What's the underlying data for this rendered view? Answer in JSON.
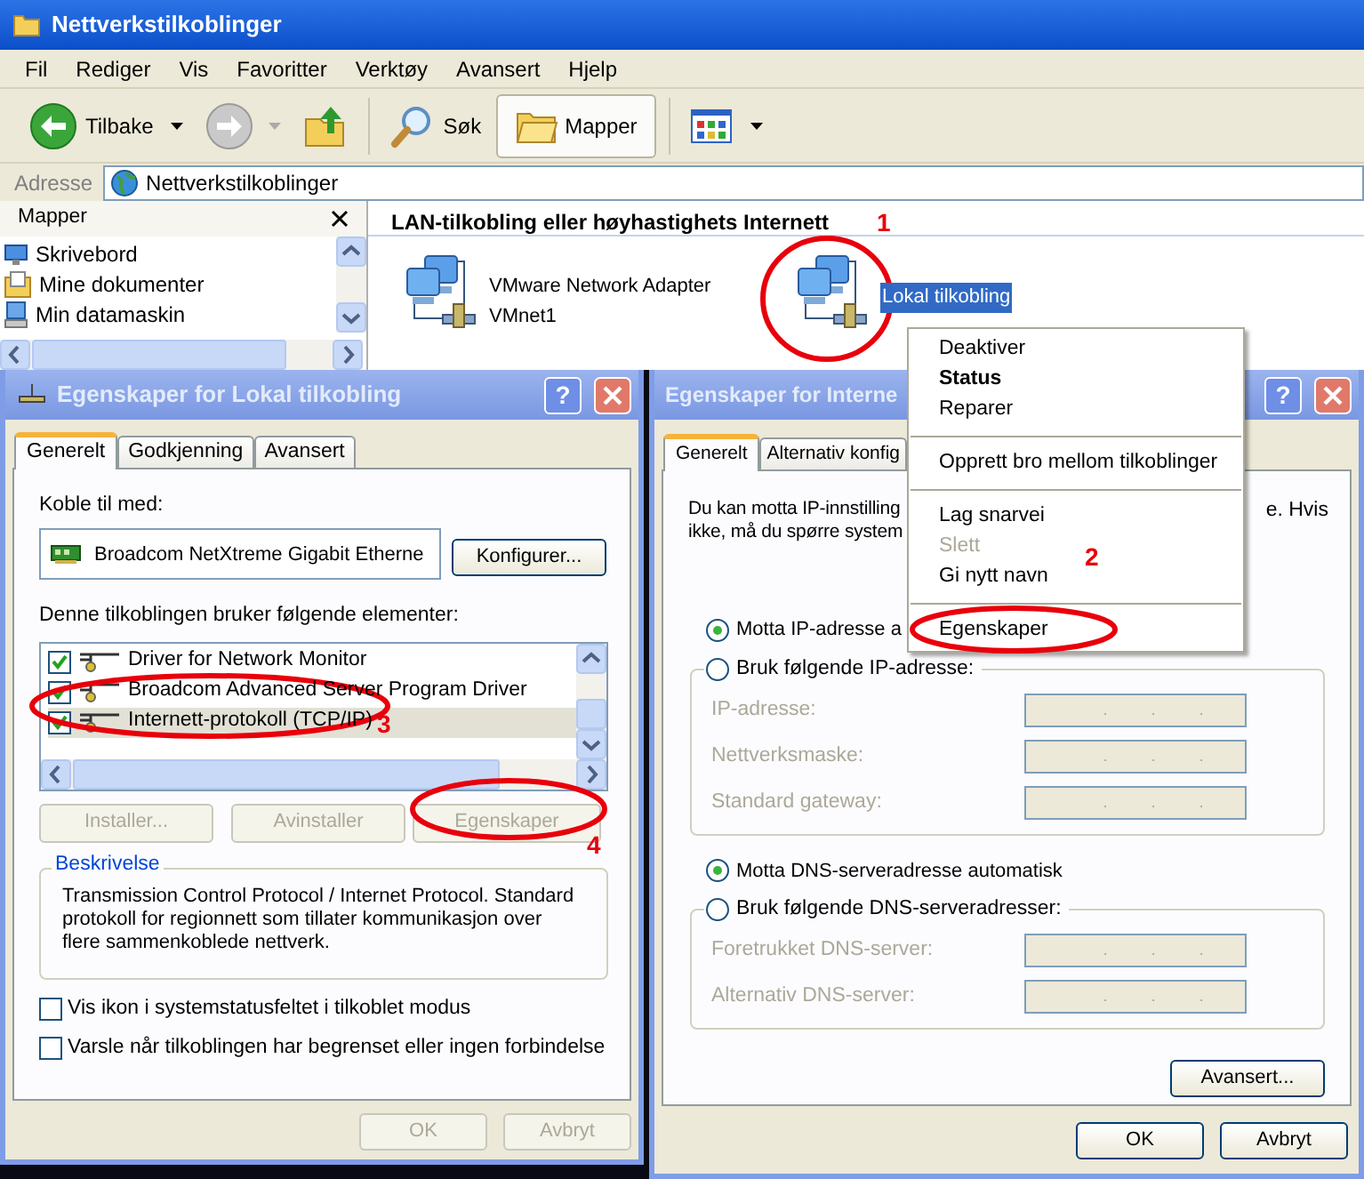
{
  "explorer": {
    "title": "Nettverkstilkoblinger",
    "menu": [
      "Fil",
      "Rediger",
      "Vis",
      "Favoritter",
      "Verktøy",
      "Avansert",
      "Hjelp"
    ],
    "toolbar": [
      {
        "kind": "back",
        "label": "Tilbake",
        "selected": false
      },
      {
        "kind": "forward",
        "selected": false
      },
      {
        "kind": "up",
        "selected": false
      },
      {
        "kind": "search",
        "label": "Søk",
        "selected": false
      },
      {
        "kind": "folders",
        "label": "Mapper",
        "selected": true
      },
      {
        "kind": "views",
        "selected": false
      }
    ],
    "address": {
      "label": "Adresse",
      "value": "Nettverkstilkoblinger"
    },
    "folders_pane": {
      "title": "Mapper",
      "items": [
        {
          "kind": "desktop",
          "label": "Skrivebord"
        },
        {
          "kind": "documents",
          "label": "Mine dokumenter"
        },
        {
          "kind": "computer",
          "label": "Min datamaskin"
        }
      ]
    },
    "section_heading": "LAN-tilkobling eller høyhastighets Internett",
    "connections": [
      {
        "name": "VMware Network Adapter",
        "detail": "VMnet1",
        "selected": false
      },
      {
        "name": "Lokal tilkobling",
        "selected": true
      }
    ]
  },
  "context_menu": [
    {
      "kind": "item",
      "label": "Deaktiver",
      "default": false,
      "disabled": false
    },
    {
      "kind": "item",
      "label": "Status",
      "default": true,
      "disabled": false
    },
    {
      "kind": "item",
      "label": "Reparer",
      "default": false,
      "disabled": false
    },
    {
      "kind": "separator"
    },
    {
      "kind": "item",
      "label": "Opprett bro mellom tilkoblinger",
      "default": false,
      "disabled": false
    },
    {
      "kind": "separator"
    },
    {
      "kind": "item",
      "label": "Lag snarvei",
      "default": false,
      "disabled": false
    },
    {
      "kind": "item",
      "label": "Slett",
      "default": false,
      "disabled": true
    },
    {
      "kind": "item",
      "label": "Gi nytt navn",
      "default": false,
      "disabled": false
    },
    {
      "kind": "separator"
    },
    {
      "kind": "item",
      "label": "Egenskaper",
      "default": false,
      "disabled": false
    }
  ],
  "left_dialog": {
    "title": "Egenskaper for Lokal tilkobling",
    "help": "?",
    "tabs": [
      {
        "label": "Generelt",
        "selected": true
      },
      {
        "label": "Godkjenning",
        "selected": false
      },
      {
        "label": "Avansert",
        "selected": false
      }
    ],
    "connect_label": "Koble til med:",
    "adapter": "Broadcom NetXtreme Gigabit Etherne",
    "configure_button": "Konfigurer...",
    "components_label": "Denne tilkoblingen bruker følgende elementer:",
    "components": [
      {
        "label": "Driver for Network Monitor",
        "checked": true,
        "selected": false
      },
      {
        "label": "Broadcom Advanced Server Program Driver",
        "checked": true,
        "selected": false
      },
      {
        "label": "Internett-protokoll (TCP/IP)",
        "checked": true,
        "selected": true
      }
    ],
    "buttons": [
      {
        "label": "Installer...",
        "disabled": true
      },
      {
        "label": "Avinstaller",
        "disabled": true
      },
      {
        "label": "Egenskaper",
        "disabled": true
      }
    ],
    "description": {
      "title": "Beskrivelse",
      "text": "Transmission Control Protocol / Internet Protocol. Standard protokoll for regionnett som tillater kommunikasjon over flere sammenkoblede nettverk."
    },
    "options": [
      {
        "label": "Vis ikon i systemstatusfeltet i tilkoblet modus",
        "checked": false
      },
      {
        "label": "Varsle når tilkoblingen har begrenset eller ingen forbindelse",
        "checked": false
      }
    ],
    "footer_buttons": [
      {
        "label": "OK",
        "disabled": true
      },
      {
        "label": "Avbryt",
        "disabled": true
      }
    ]
  },
  "right_dialog": {
    "title": "Egenskaper for Interne",
    "help": "?",
    "tabs": [
      {
        "label": "Generelt",
        "selected": true
      },
      {
        "label": "Alternativ konfig",
        "selected": false
      }
    ],
    "intro": [
      {
        "left": "Du kan motta IP-innstilling",
        "right": "e. Hvis"
      },
      {
        "left": "ikke, må du spørre system"
      }
    ],
    "ip_radios": [
      {
        "label": "Motta IP-adresse a",
        "selected": true
      },
      {
        "label": "Bruk følgende IP-adresse:",
        "selected": false
      }
    ],
    "ip_fields": [
      {
        "label": "IP-adresse:",
        "value": ". . .",
        "disabled": true
      },
      {
        "label": "Nettverksmaske:",
        "value": ". . .",
        "disabled": true
      },
      {
        "label": "Standard gateway:",
        "value": ". . .",
        "disabled": true
      }
    ],
    "dns_radios": [
      {
        "label": "Motta DNS-serveradresse automatisk",
        "selected": true
      },
      {
        "label": "Bruk følgende DNS-serveradresser:",
        "selected": false
      }
    ],
    "dns_fields": [
      {
        "label": "Foretrukket DNS-server:",
        "value": ". . .",
        "disabled": true
      },
      {
        "label": "Alternativ DNS-server:",
        "value": ". . .",
        "disabled": true
      }
    ],
    "advanced_button": "Avansert...",
    "footer_buttons": [
      {
        "label": "OK",
        "disabled": false
      },
      {
        "label": "Avbryt",
        "disabled": false
      }
    ]
  },
  "annotations": [
    {
      "label": "1"
    },
    {
      "label": "2"
    },
    {
      "label": "3"
    },
    {
      "label": "4"
    }
  ]
}
